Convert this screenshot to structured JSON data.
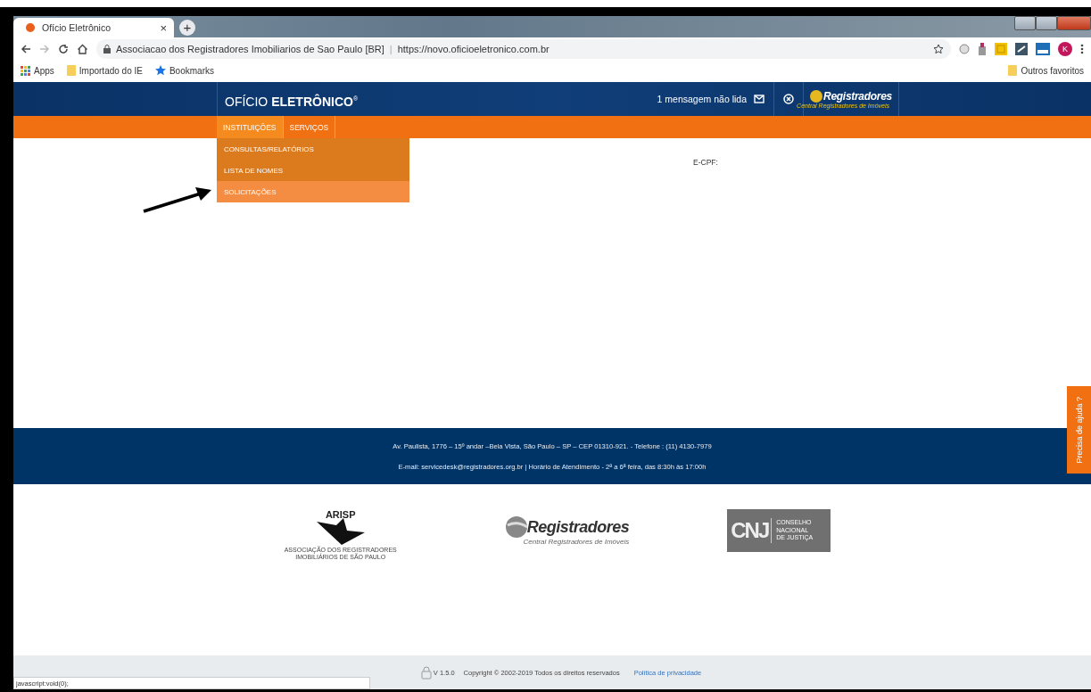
{
  "browser": {
    "tabs": [
      {
        "title": "Ofício Eletrônico",
        "close": "×",
        "selected": true
      }
    ],
    "new_tab": "+",
    "address": {
      "site": "Associacao dos Registradores Imobiliarios de Sao Paulo [BR]",
      "separator": "|",
      "url": "https://novo.oficioeletronico.com.br"
    },
    "profile": "K",
    "bookmarks": [
      {
        "kind": "apps",
        "label": "Apps"
      },
      {
        "kind": "folder",
        "label": "Importado do IE"
      },
      {
        "kind": "star",
        "label": "Bookmarks"
      }
    ],
    "other_bookmarks": "Outros favoritos"
  },
  "header": {
    "brand": "OFÍCIO **ELETRÔNICO**$^{®}$",
    "messages": "1 mensagem não lida",
    "partner_logo": {
      "name": "Registradores",
      "subtitle": "Central Registradores de Imóveis"
    }
  },
  "nav": [
    {
      "label": "INSTITUIÇÕES",
      "selected": true
    },
    {
      "label": "SERVIÇOS",
      "selected": false
    }
  ],
  "dropdown": [
    {
      "label": "CONSULTAS/RELATÓRIOS",
      "selected": false
    },
    {
      "label": "LISTA DE NOMES",
      "selected": false
    },
    {
      "label": "SOLICITAÇÕES",
      "selected": true
    }
  ],
  "content": {
    "ecpf_label": "E-CPF:"
  },
  "help_tab": "Precisa de ajuda ?",
  "footer": {
    "lines": [
      "Av. Paulista, 1776 – 15º andar –Bela Vista, São Paulo – SP – CEP 01310-921. - Telefone : (11) 4130-7979",
      "E-mail: servicedesk@registradores.org.br | Horário de Atendimento - 2ª a 6ª feira, das 8:30h às 17:00h"
    ]
  },
  "partners": {
    "arisp": {
      "name": "ARISP",
      "subtitle": "ASSOCIAÇÃO DOS REGISTRADORES IMOBILIÁRIOS DE SÃO PAULO"
    },
    "registradores": {
      "name": "Registradores",
      "subtitle": "Central Registradores de Imóveis"
    },
    "cnj": {
      "name": "CNJ",
      "lines": [
        "CONSELHO",
        "NACIONAL",
        "DE JUSTIÇA"
      ]
    }
  },
  "bottom_bar": {
    "version": "V 1.5.0",
    "copyright": "Copyright © 2002-2019 Todos os direitos reservados",
    "privacy_link": "Política de privacidade"
  },
  "status_link": "javascript:void(0);"
}
